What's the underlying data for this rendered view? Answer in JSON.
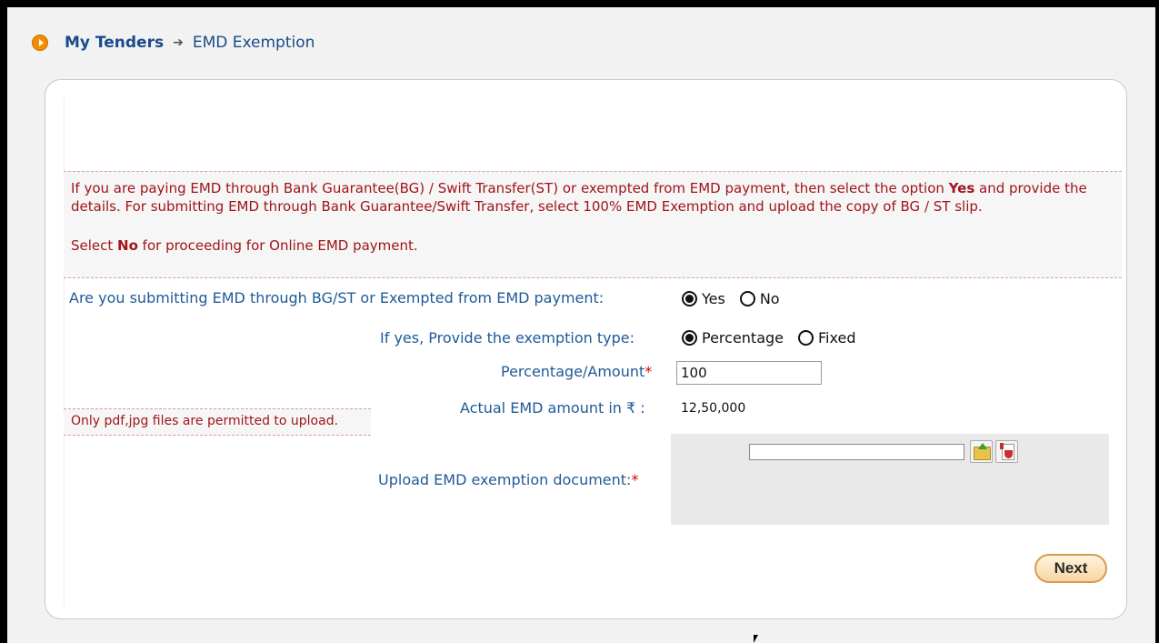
{
  "breadcrumb": {
    "root": "My Tenders",
    "separator": "➔",
    "current": "EMD Exemption"
  },
  "notice": {
    "text_before_yes": "If you are paying EMD through Bank Guarantee(BG) / Swift Transfer(ST) or exempted from EMD payment, then select the option ",
    "yes_bold": "Yes",
    "text_after_yes": " and provide the details. For submitting EMD through Bank Guarantee/Swift Transfer, select 100% EMD Exemption and upload the copy of BG / ST slip.",
    "select": "Select ",
    "no_bold": "No",
    "text_after_no": " for proceeding for Online EMD payment."
  },
  "form": {
    "question_label": "Are you submitting EMD through BG/ST or Exempted from EMD payment:",
    "yes_label": "Yes",
    "no_label": "No",
    "selected_answer": "Yes",
    "exemption_type_label": "If yes, Provide the exemption type:",
    "percentage_label": "Percentage",
    "fixed_label": "Fixed",
    "selected_exemption_type": "Percentage",
    "amount_label": "Percentage/Amount",
    "amount_value": "100",
    "actual_label": "Actual EMD amount in ₹ :",
    "actual_value": "12,50,000",
    "upload_label": "Upload EMD exemption document:",
    "required_mark": "*"
  },
  "permit_text": "Only pdf,jpg files are permitted to upload.",
  "next_label": "Next"
}
